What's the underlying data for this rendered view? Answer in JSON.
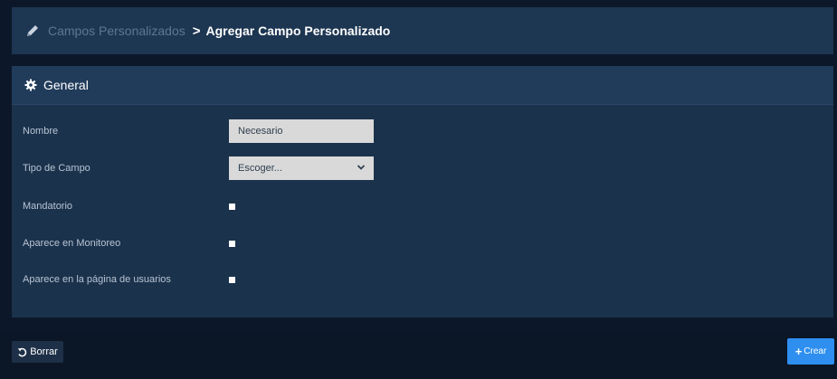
{
  "header": {
    "breadcrumb_parent": "Campos Personalizados",
    "breadcrumb_separator": ">",
    "breadcrumb_current": "Agregar Campo Personalizado",
    "icon": "pencil-icon"
  },
  "panel": {
    "title": "General",
    "icon": "gear-icon"
  },
  "form": {
    "name_label": "Nombre",
    "name_placeholder": "Necesario",
    "field_type_label": "Tipo de Campo",
    "field_type_selected": "Escoger...",
    "mandatory_label": "Mandatorio",
    "monitoring_label": "Aparece en Monitoreo",
    "users_page_label": "Aparece en la página de usuarios"
  },
  "footer": {
    "reset_label": "Borrar",
    "reset_icon": "undo-icon",
    "create_label": "Crear",
    "create_icon": "plus-icon"
  },
  "colors": {
    "background": "#0c1829",
    "header": "#1d3652",
    "panel": "#1b324c",
    "panel_head": "#213c5b",
    "accent": "#2e8ff0"
  }
}
